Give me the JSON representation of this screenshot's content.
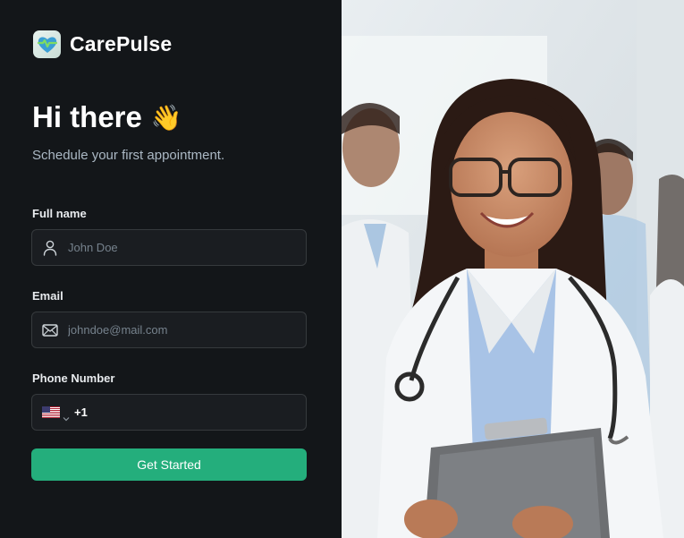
{
  "app": {
    "name": "CarePulse"
  },
  "hero": {
    "title": "Hi there",
    "emoji": "👋",
    "subtitle": "Schedule your first appointment."
  },
  "form": {
    "full_name": {
      "label": "Full name",
      "placeholder": "John Doe",
      "icon": "user-icon"
    },
    "email": {
      "label": "Email",
      "placeholder": "johndoe@mail.com",
      "icon": "mail-icon"
    },
    "phone": {
      "label": "Phone Number",
      "country_code": "+1",
      "country": "US",
      "icon": "us-flag-icon"
    },
    "submit_label": "Get Started"
  },
  "colors": {
    "background": "#131619",
    "field_bg": "#1a1d21",
    "field_border": "#363a3d",
    "accent": "#24ae7c"
  }
}
